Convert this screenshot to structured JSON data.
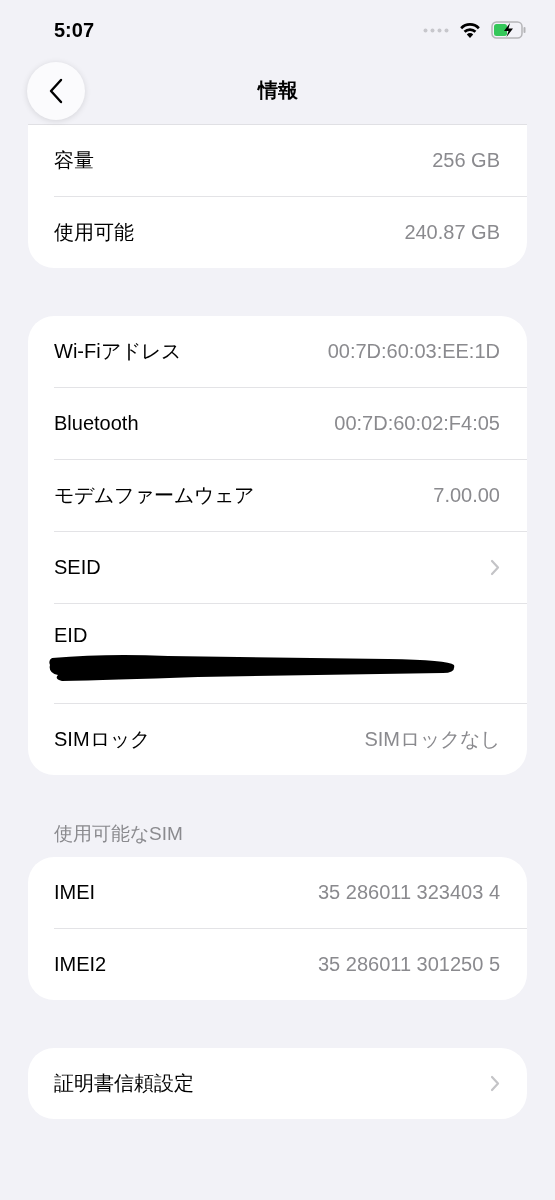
{
  "status_bar": {
    "time": "5:07"
  },
  "nav": {
    "title": "情報"
  },
  "sections": [
    {
      "cut_top": true,
      "rows": [
        {
          "kind": "value",
          "label": "容量",
          "value": "256 GB"
        },
        {
          "kind": "value",
          "label": "使用可能",
          "value": "240.87 GB"
        }
      ]
    },
    {
      "cut_top": false,
      "rows": [
        {
          "kind": "value",
          "label": "Wi-Fiアドレス",
          "value": "00:7D:60:03:EE:1D"
        },
        {
          "kind": "value",
          "label": "Bluetooth",
          "value": "00:7D:60:02:F4:05"
        },
        {
          "kind": "value",
          "label": "モデムファームウェア",
          "value": "7.00.00"
        },
        {
          "kind": "chevron",
          "label": "SEID"
        },
        {
          "kind": "redacted",
          "label": "EID"
        },
        {
          "kind": "value",
          "label": "SIMロック",
          "value": "SIMロックなし"
        }
      ]
    },
    {
      "header": "使用可能なSIM",
      "cut_top": false,
      "rows": [
        {
          "kind": "value",
          "label": "IMEI",
          "value": "35 286011 323403 4"
        },
        {
          "kind": "value",
          "label": "IMEI2",
          "value": "35 286011 301250 5"
        }
      ]
    },
    {
      "cut_top": false,
      "rows": [
        {
          "kind": "chevron",
          "label": "証明書信頼設定"
        }
      ]
    }
  ]
}
